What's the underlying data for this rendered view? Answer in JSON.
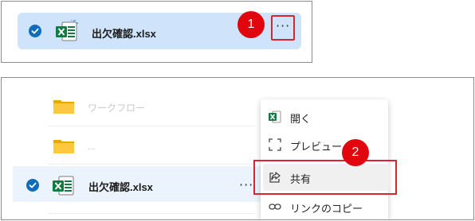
{
  "panel1": {
    "file_name": "出欠確認.xlsx",
    "more_label": "···",
    "step_badge": "1"
  },
  "panel2": {
    "folders": [
      {
        "name": "ワークフロー"
      },
      {
        "name": "..."
      }
    ],
    "file_name": "出欠確認.xlsx",
    "more_label": "···",
    "step_badge": "2",
    "context_menu": [
      {
        "label": "開く",
        "icon": "excel-icon"
      },
      {
        "label": "プレビュー",
        "icon": "preview-icon"
      },
      {
        "label": "共有",
        "icon": "share-icon"
      },
      {
        "label": "リンクのコピー",
        "icon": "link-icon"
      }
    ]
  },
  "colors": {
    "selection": "#cfe4fa",
    "accent": "#0f6cbd",
    "highlight_red": "#d9262e",
    "badge_red": "#e1060d",
    "excel_green": "#107c41"
  }
}
